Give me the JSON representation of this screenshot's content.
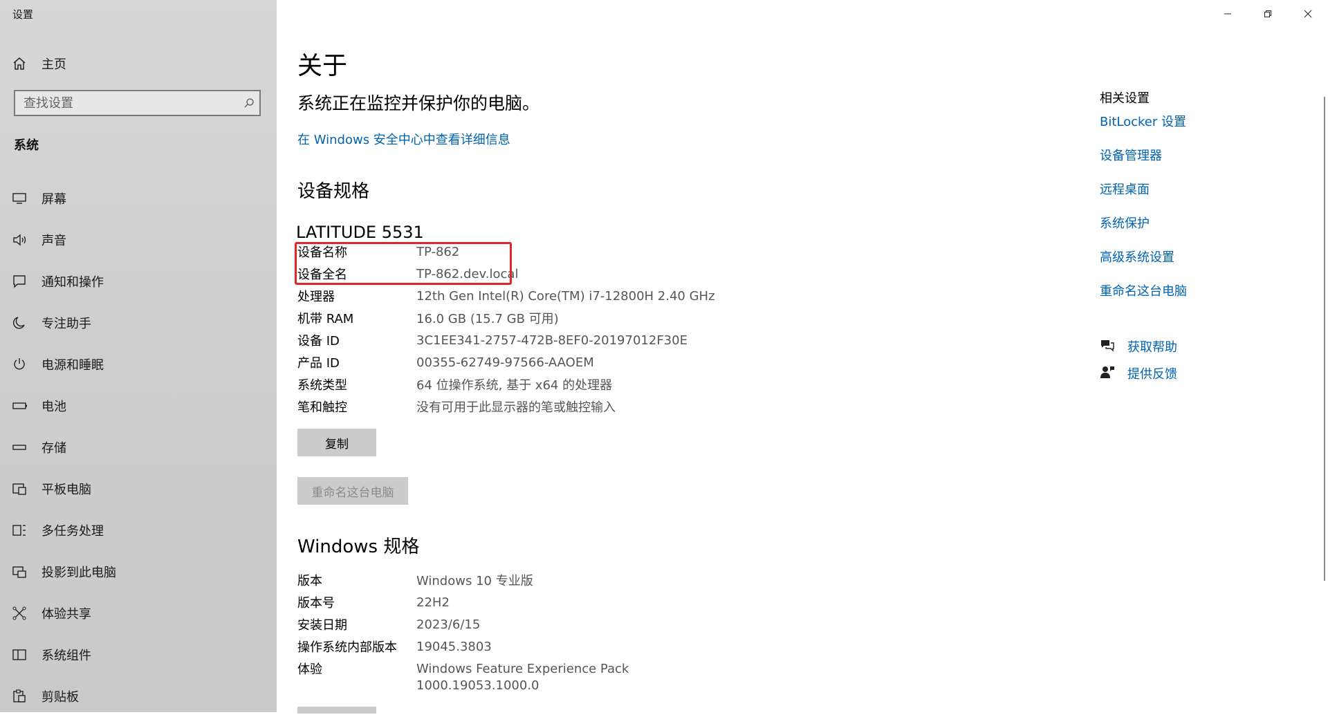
{
  "window": {
    "title": "设置"
  },
  "sidebar": {
    "home_label": "主页",
    "search_placeholder": "查找设置",
    "section": "系统",
    "items": [
      {
        "label": "屏幕",
        "icon": "monitor-icon"
      },
      {
        "label": "声音",
        "icon": "speaker-icon"
      },
      {
        "label": "通知和操作",
        "icon": "notification-icon"
      },
      {
        "label": "专注助手",
        "icon": "moon-icon"
      },
      {
        "label": "电源和睡眠",
        "icon": "power-icon"
      },
      {
        "label": "电池",
        "icon": "battery-icon"
      },
      {
        "label": "存储",
        "icon": "storage-icon"
      },
      {
        "label": "平板电脑",
        "icon": "tablet-icon"
      },
      {
        "label": "多任务处理",
        "icon": "multitask-icon"
      },
      {
        "label": "投影到此电脑",
        "icon": "project-icon"
      },
      {
        "label": "体验共享",
        "icon": "share-icon"
      },
      {
        "label": "系统组件",
        "icon": "components-icon"
      },
      {
        "label": "剪贴板",
        "icon": "clipboard-icon"
      }
    ]
  },
  "main": {
    "title": "关于",
    "status": "系统正在监控并保护你的电脑。",
    "security_link": "在 Windows 安全中心中查看详细信息",
    "device_spec_heading": "设备规格",
    "model": "LATITUDE 5531",
    "device_specs": [
      {
        "key": "设备名称",
        "value": "TP-862"
      },
      {
        "key": "设备全名",
        "value": "TP-862.dev.local"
      },
      {
        "key": "处理器",
        "value": "12th Gen Intel(R) Core(TM) i7-12800H   2.40 GHz"
      },
      {
        "key": "机带 RAM",
        "value": "16.0 GB (15.7 GB 可用)"
      },
      {
        "key": "设备 ID",
        "value": "3C1EE341-2757-472B-8EF0-20197012F30E"
      },
      {
        "key": "产品 ID",
        "value": "00355-62749-97566-AAOEM"
      },
      {
        "key": "系统类型",
        "value": "64 位操作系统, 基于 x64 的处理器"
      },
      {
        "key": "笔和触控",
        "value": "没有可用于此显示器的笔或触控输入"
      }
    ],
    "copy_button": "复制",
    "rename_button": "重命名这台电脑",
    "windows_spec_heading": "Windows 规格",
    "windows_specs": [
      {
        "key": "版本",
        "value": "Windows 10 专业版"
      },
      {
        "key": "版本号",
        "value": "22H2"
      },
      {
        "key": "安装日期",
        "value": "2023/6/15"
      },
      {
        "key": "操作系统内部版本",
        "value": "19045.3803"
      },
      {
        "key": "体验",
        "value": "Windows Feature Experience Pack"
      }
    ],
    "experience_line2": "1000.19053.1000.0"
  },
  "related": {
    "title": "相关设置",
    "links": [
      "BitLocker 设置",
      "设备管理器",
      "远程桌面",
      "系统保护",
      "高级系统设置",
      "重命名这台电脑"
    ],
    "help": "获取帮助",
    "feedback": "提供反馈"
  },
  "colors": {
    "link": "#0063b1",
    "highlight": "#e0252b",
    "sidebar_bg": "#cfcfcf"
  }
}
